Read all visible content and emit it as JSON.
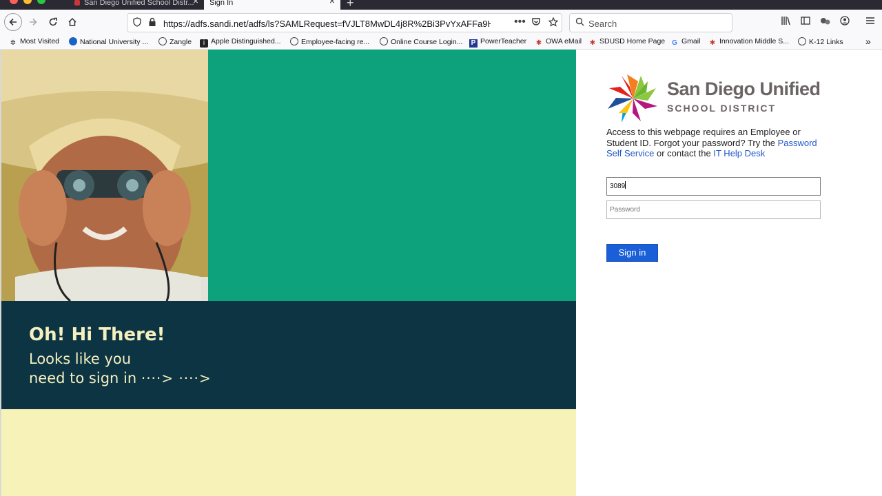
{
  "browser": {
    "tabs": [
      {
        "label": "San Diego Unified School Distr..."
      },
      {
        "label": "Sign In"
      }
    ],
    "url": "https://adfs.sandi.net/adfs/ls?SAMLRequest=fVJLT8MwDL4j8R%2Bi3PvYxAFFa9HY",
    "search_placeholder": "Search",
    "bookmarks": [
      {
        "label": "Most Visited",
        "icon": "gear-icon"
      },
      {
        "label": "National University ...",
        "icon": "nu-icon"
      },
      {
        "label": "Zangle",
        "icon": "globe-icon"
      },
      {
        "label": "Apple Distinguished...",
        "icon": "apple-icon"
      },
      {
        "label": "Employee-facing re...",
        "icon": "globe-icon"
      },
      {
        "label": "Online Course Login...",
        "icon": "globe-icon"
      },
      {
        "label": "PowerTeacher",
        "icon": "p-icon"
      },
      {
        "label": "OWA eMail",
        "icon": "star-logo-icon"
      },
      {
        "label": "SDUSD Home Page",
        "icon": "star-logo-icon"
      },
      {
        "label": "Gmail",
        "icon": "g-icon"
      },
      {
        "label": "Innovation Middle S...",
        "icon": "star-logo-icon"
      },
      {
        "label": "K-12 Links",
        "icon": "globe-icon"
      }
    ]
  },
  "banner": {
    "headline": "Oh! Hi There!",
    "line1": "Looks like you",
    "line2": "need to sign in",
    "arrows": "····> ····>"
  },
  "logo": {
    "name": "San Diego Unified",
    "sub": "SCHOOL DISTRICT"
  },
  "intro": {
    "text1": "Access to this webpage requires an Employee or Student ID. Forgot your password? Try the ",
    "link1": "Password Self Service",
    "text2": " or contact the ",
    "link2": "IT Help Desk"
  },
  "form": {
    "username_value": "3089",
    "password_placeholder": "Password",
    "signin_label": "Sign in"
  },
  "colors": {
    "green": "#0ea27c",
    "navy": "#0d3443",
    "cream": "#f7f2b8",
    "button": "#1a5fd8"
  }
}
